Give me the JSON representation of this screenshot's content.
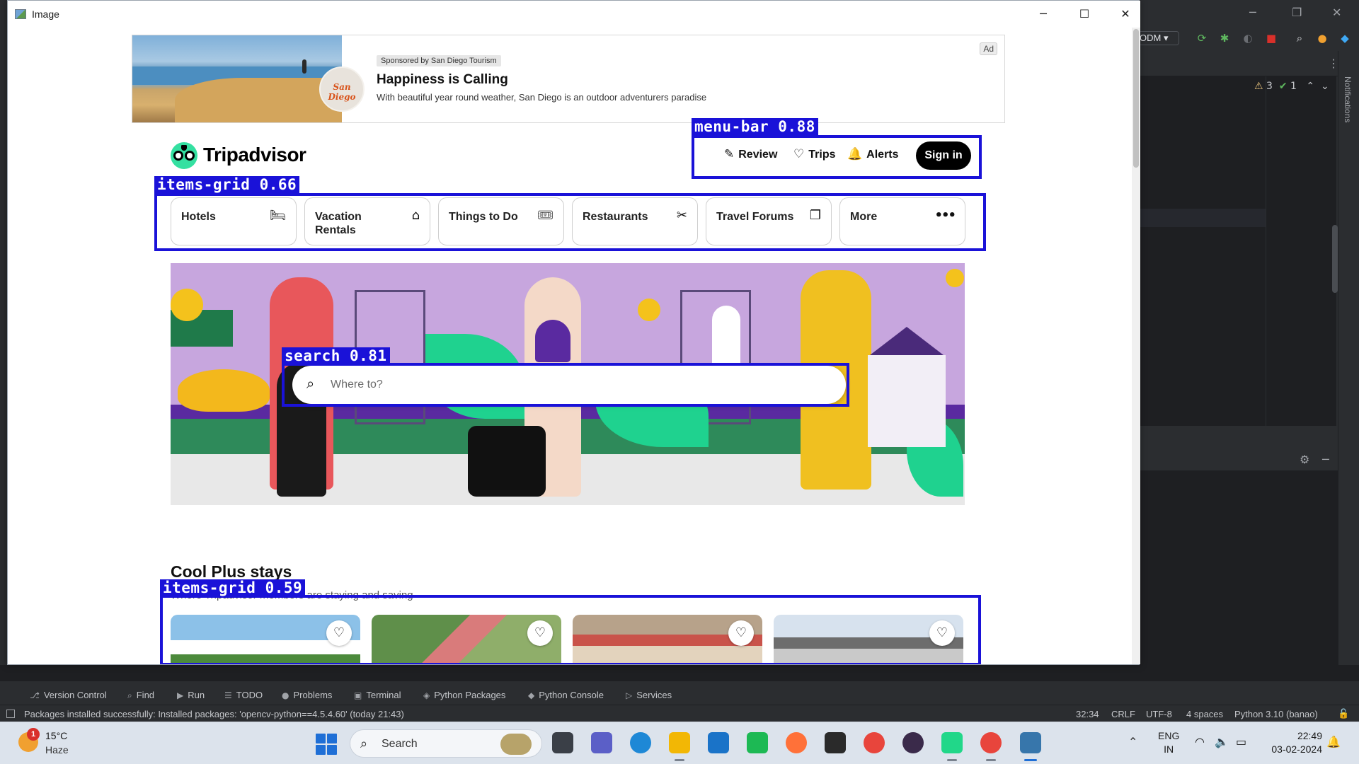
{
  "window": {
    "title": "Image",
    "controls": {
      "minimize": "─",
      "maximize": "☐",
      "close": "✕"
    }
  },
  "ad": {
    "sponsor": "Sponsored by San Diego Tourism",
    "headline": "Happiness is Calling",
    "body": "With beautiful year round weather, San Diego is an outdoor adventurers paradise",
    "badge": "Ad",
    "logo_text": "San Diego"
  },
  "tripadvisor": {
    "brand": "Tripadvisor",
    "menu": {
      "review": "Review",
      "trips": "Trips",
      "alerts": "Alerts",
      "sign_in": "Sign in"
    },
    "nav": [
      {
        "label": "Hotels",
        "icon": "bed-icon",
        "glyph": "🛏"
      },
      {
        "label": "Vacation Rentals",
        "icon": "house-icon",
        "glyph": "⌂"
      },
      {
        "label": "Things to Do",
        "icon": "ticket-icon",
        "glyph": "🎟"
      },
      {
        "label": "Restaurants",
        "icon": "cutlery-icon",
        "glyph": "✂"
      },
      {
        "label": "Travel Forums",
        "icon": "chat-icon",
        "glyph": "❐"
      },
      {
        "label": "More",
        "icon": "more-icon",
        "glyph": "•••"
      }
    ],
    "search": {
      "placeholder": "Where to?"
    },
    "section": {
      "title": "Cool Plus stays",
      "subtitle": "Where Tripadvisor members are staying and saving"
    },
    "stays": [
      {
        "colors": [
          "#8cc1e8",
          "#ffffff"
        ]
      },
      {
        "colors": [
          "#5f8f4a",
          "#d97b7b"
        ]
      },
      {
        "colors": [
          "#b7a28a",
          "#c9534a"
        ]
      },
      {
        "colors": [
          "#d7e2ee",
          "#6d6d6d"
        ]
      }
    ]
  },
  "detections": [
    {
      "label": "menu-bar 0.88"
    },
    {
      "label": "items-grid 0.66"
    },
    {
      "label": "search 0.81"
    },
    {
      "label": "items-grid 0.59"
    }
  ],
  "ide": {
    "run_config": "ODM",
    "inspections": {
      "warnings": "3",
      "ok": "1"
    },
    "notifications_label": "Notifications",
    "tool_tabs": [
      {
        "label": "Version Control",
        "icon": "⎇"
      },
      {
        "label": "Find",
        "icon": "⌕"
      },
      {
        "label": "Run",
        "icon": "▶"
      },
      {
        "label": "TODO",
        "icon": "☰"
      },
      {
        "label": "Problems",
        "icon": "●"
      },
      {
        "label": "Terminal",
        "icon": "▣"
      },
      {
        "label": "Python Packages",
        "icon": "◈"
      },
      {
        "label": "Python Console",
        "icon": "◆"
      },
      {
        "label": "Services",
        "icon": "▷"
      }
    ],
    "status_message": "Packages installed successfully: Installed packages: 'opencv-python==4.5.4.60' (today 21:43)",
    "status_right": {
      "position": "32:34",
      "line_ending": "CRLF",
      "encoding": "UTF-8",
      "indent": "4 spaces",
      "interpreter": "Python 3.10 (banao)"
    }
  },
  "taskbar": {
    "weather": {
      "temp": "15°C",
      "desc": "Haze",
      "badge": "1"
    },
    "search_label": "Search",
    "apps": [
      {
        "name": "task-view",
        "color": "#3a3f47"
      },
      {
        "name": "teams",
        "color": "#5b5fc7"
      },
      {
        "name": "edge",
        "color": "#1e88d6"
      },
      {
        "name": "file-explorer",
        "color": "#f2b705"
      },
      {
        "name": "mail",
        "color": "#1a73c8"
      },
      {
        "name": "spotify",
        "color": "#1db954"
      },
      {
        "name": "firefox",
        "color": "#ff7139"
      },
      {
        "name": "epic-app",
        "color": "#2a2a2a"
      },
      {
        "name": "chrome",
        "color": "#e8453c"
      },
      {
        "name": "media-app",
        "color": "#3a2a4a"
      },
      {
        "name": "pycharm",
        "color": "#21d789"
      },
      {
        "name": "chrome-profile",
        "color": "#e8453c"
      },
      {
        "name": "python-image",
        "color": "#3776ab"
      }
    ],
    "lang": "ENG",
    "region": "IN",
    "time": "22:49",
    "date": "03-02-2024"
  }
}
